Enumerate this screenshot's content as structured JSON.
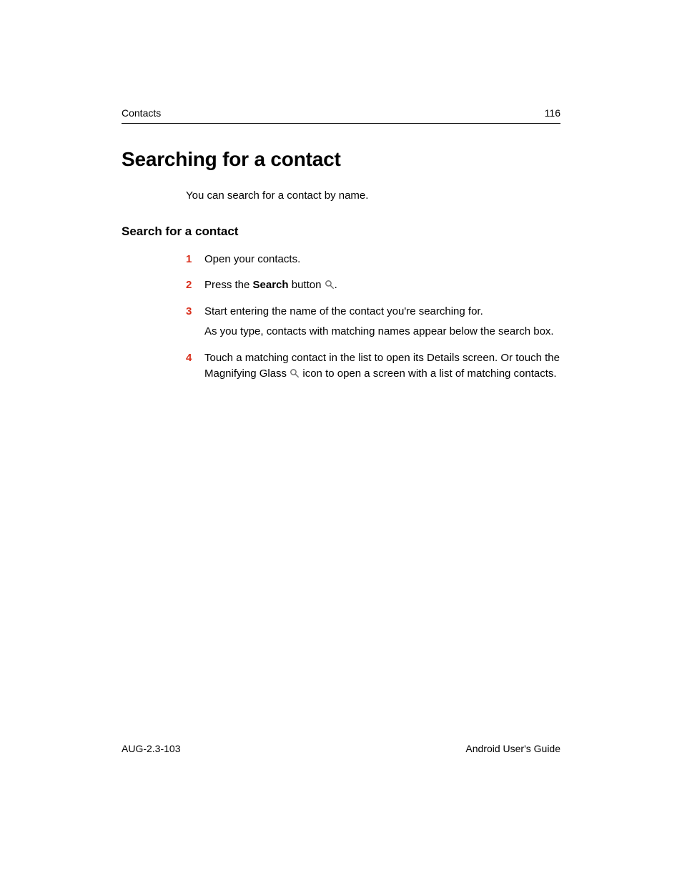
{
  "header": {
    "section": "Contacts",
    "page_number": "116"
  },
  "title": "Searching for a contact",
  "intro": "You can search for a contact by name.",
  "subheading": "Search for a contact",
  "steps": {
    "s1": "Open your contacts.",
    "s2_a": "Press the ",
    "s2_b": "Search",
    "s2_c": " button ",
    "s2_period": ".",
    "s3_a": "Start entering the name of the contact you're searching for.",
    "s3_b": "As you type, contacts with matching names appear below the search box.",
    "s4_a": "Touch a matching contact in the list to open its Details screen. Or touch the Magnifying Glass ",
    "s4_b": " icon to open a screen with a list of matching contacts."
  },
  "footer": {
    "doc_id": "AUG-2.3-103",
    "doc_title": "Android User's Guide"
  }
}
